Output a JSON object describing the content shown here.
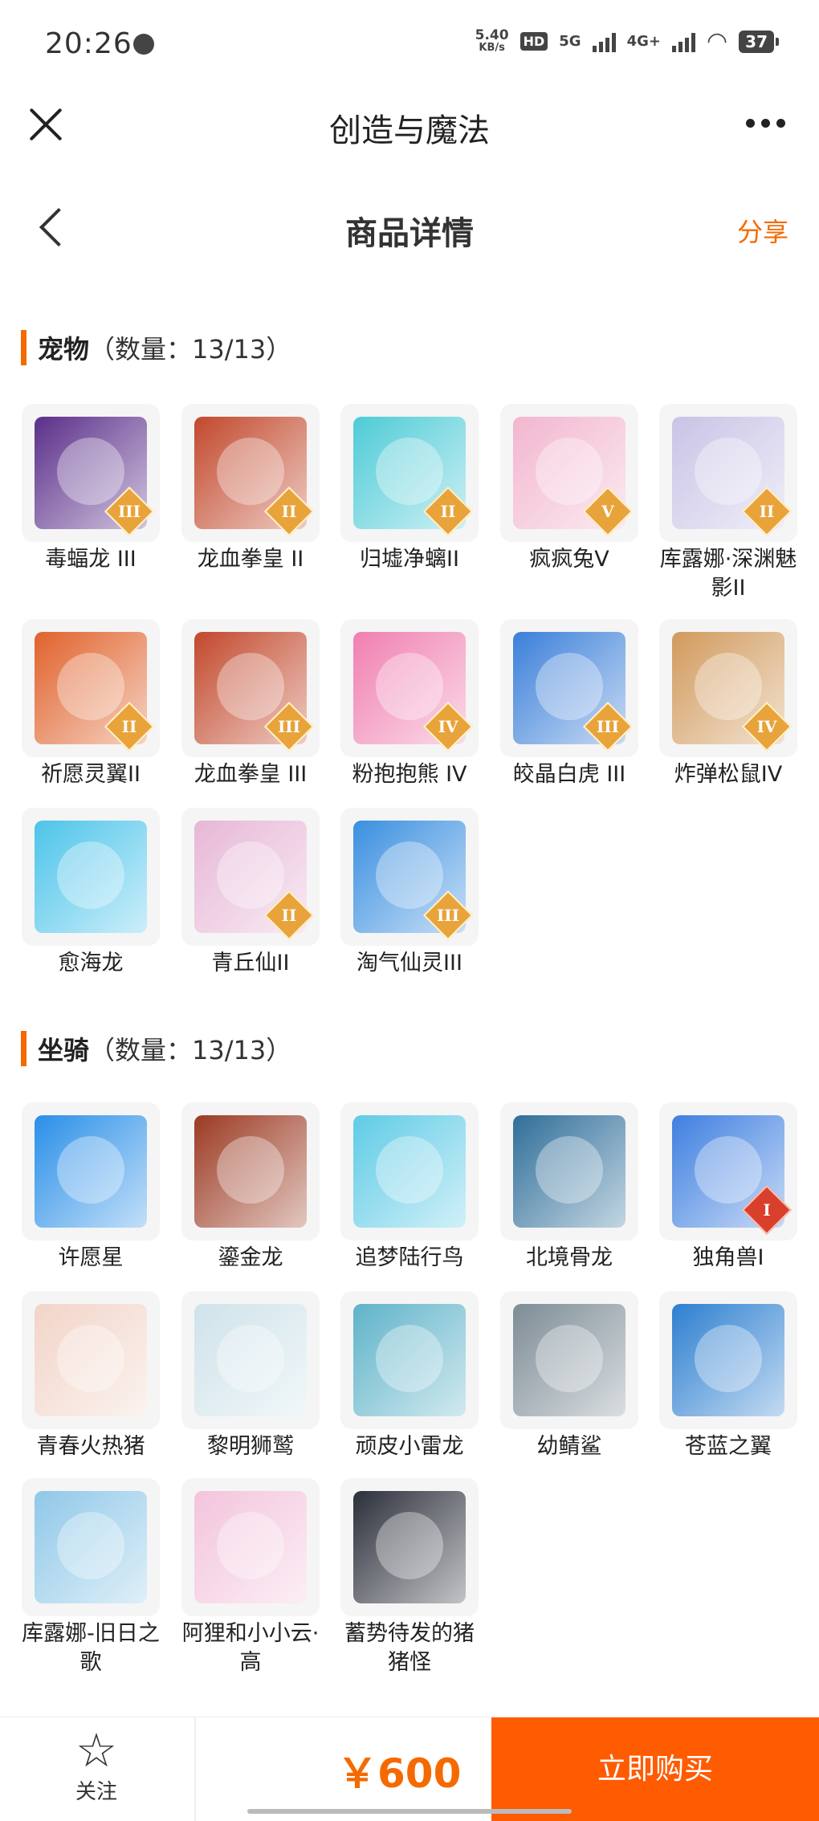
{
  "status_bar": {
    "time": "20:26",
    "net_speed_value": "5.40",
    "net_speed_unit": "KB/s",
    "hd_label": "HD",
    "five_g": "5G",
    "four_g": "4G+",
    "battery": "37"
  },
  "app_header": {
    "title": "创造与魔法"
  },
  "page_header": {
    "title": "商品详情",
    "share": "分享"
  },
  "pets": {
    "name": "宠物",
    "count": "（数量：13/13）",
    "items": [
      {
        "label": "毒蝠龙 III",
        "tier": "III",
        "color": "#5b2f8a"
      },
      {
        "label": "龙血拳皇 II",
        "tier": "II",
        "color": "#c2482c"
      },
      {
        "label": "归墟净螭II",
        "tier": "II",
        "color": "#4ecbd6"
      },
      {
        "label": "疯疯兔V",
        "tier": "V",
        "color": "#f2b6cf"
      },
      {
        "label": "库露娜·深渊魅影II",
        "tier": "II",
        "color": "#c9c3e6"
      },
      {
        "label": "祈愿灵翼II",
        "tier": "II",
        "color": "#e0622b"
      },
      {
        "label": "龙血拳皇 III",
        "tier": "III",
        "color": "#c2482c"
      },
      {
        "label": "粉抱抱熊 IV",
        "tier": "IV",
        "color": "#f07fb0"
      },
      {
        "label": "皎晶白虎 III",
        "tier": "III",
        "color": "#3b7fd9"
      },
      {
        "label": "炸弹松鼠IV",
        "tier": "IV",
        "color": "#d19a5c"
      },
      {
        "label": "愈海龙",
        "tier": "",
        "color": "#4cc4ea"
      },
      {
        "label": "青丘仙II",
        "tier": "II",
        "color": "#e7b7d6"
      },
      {
        "label": "淘气仙灵III",
        "tier": "III",
        "color": "#3a8fe0"
      }
    ]
  },
  "mounts": {
    "name": "坐骑",
    "count": "（数量：13/13）",
    "items": [
      {
        "label": "许愿星",
        "tier": "",
        "color": "#2a8fe8"
      },
      {
        "label": "鎏金龙",
        "tier": "",
        "color": "#9b3a22"
      },
      {
        "label": "追梦陆行鸟",
        "tier": "",
        "color": "#5fcbe6"
      },
      {
        "label": "北境骨龙",
        "tier": "",
        "color": "#2f6e99"
      },
      {
        "label": "独角兽I",
        "tier": "I",
        "color": "#3e7fe0",
        "tier_style": "red"
      },
      {
        "label": "青春火热猪",
        "tier": "",
        "color": "#f2d4c8"
      },
      {
        "label": "黎明狮鹫",
        "tier": "",
        "color": "#cfe3ea"
      },
      {
        "label": "顽皮小雷龙",
        "tier": "",
        "color": "#5fb3c9"
      },
      {
        "label": "幼鲭鲨",
        "tier": "",
        "color": "#7d8c96"
      },
      {
        "label": "苍蓝之翼",
        "tier": "",
        "color": "#2d7fd0"
      },
      {
        "label": "库露娜-旧日之歌",
        "tier": "",
        "color": "#8fc8e8"
      },
      {
        "label": "阿狸和小小云·高",
        "tier": "",
        "color": "#f3c4dc"
      },
      {
        "label": "蓄势待发的猪猪怪",
        "tier": "",
        "color": "#2b2f3a"
      }
    ]
  },
  "footer": {
    "fav_label": "关注",
    "price": "￥600",
    "buy_label": "立即购买"
  }
}
